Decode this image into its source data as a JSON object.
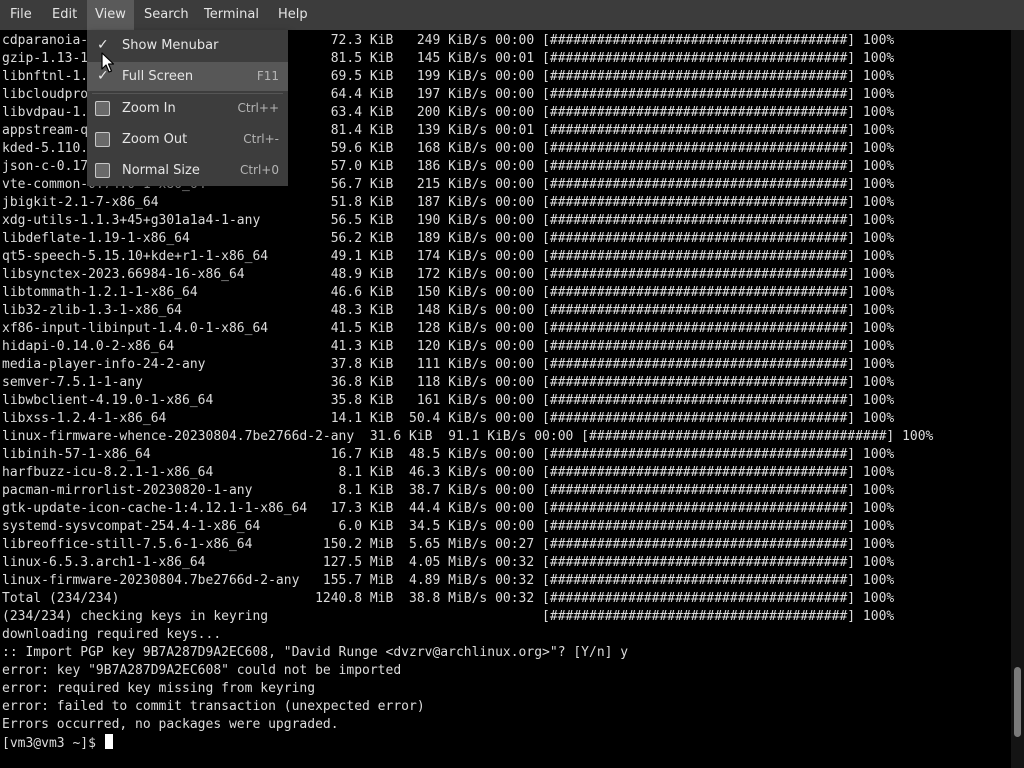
{
  "menubar": {
    "items": [
      {
        "label": "File"
      },
      {
        "label": "Edit"
      },
      {
        "label": "View"
      },
      {
        "label": "Search"
      },
      {
        "label": "Terminal"
      },
      {
        "label": "Help"
      }
    ]
  },
  "view_menu": {
    "items": [
      {
        "label": "Show Menubar",
        "accel": "",
        "checked": true
      },
      {
        "label": "Full Screen",
        "accel": "F11",
        "checked": true
      },
      {
        "label": "Zoom In",
        "accel": "Ctrl++",
        "icon": "zoom-in-icon"
      },
      {
        "label": "Zoom Out",
        "accel": "Ctrl+-",
        "icon": "zoom-out-icon"
      },
      {
        "label": "Normal Size",
        "accel": "Ctrl+0",
        "icon": "zoom-reset-icon"
      }
    ],
    "check_glyph": "✓"
  },
  "terminal": {
    "lines": [
      "cdparanoia-10.2-9-x86_64                  72.3 KiB   249 KiB/s 00:00 [######################################] 100%",
      "gzip-1.13-1-x86_64                        81.5 KiB   145 KiB/s 00:01 [######################################] 100%",
      "libnftnl-1.2.6-1-x86_64                   69.5 KiB   199 KiB/s 00:00 [######################################] 100%",
      "libcloudproviders-0.3.4-1-x86_64          64.4 KiB   197 KiB/s 00:00 [######################################] 100%",
      "libvdpau-1.5-2-x86_64                     63.4 KiB   200 KiB/s 00:00 [######################################] 100%",
      "appstream-qt-0.16.3-1-x86_64              81.4 KiB   139 KiB/s 00:01 [######################################] 100%",
      "kded-5.110.0-1-x86_64                     59.6 KiB   168 KiB/s 00:00 [######################################] 100%",
      "json-c-0.17-1-x86_64                      57.0 KiB   186 KiB/s 00:00 [######################################] 100%",
      "vte-common-0.74.0-1-x86_64                56.7 KiB   215 KiB/s 00:00 [######################################] 100%",
      "jbigkit-2.1-7-x86_64                      51.8 KiB   187 KiB/s 00:00 [######################################] 100%",
      "xdg-utils-1.1.3+45+g301a1a4-1-any         56.5 KiB   190 KiB/s 00:00 [######################################] 100%",
      "libdeflate-1.19-1-x86_64                  56.2 KiB   189 KiB/s 00:00 [######################################] 100%",
      "qt5-speech-5.15.10+kde+r1-1-x86_64        49.1 KiB   174 KiB/s 00:00 [######################################] 100%",
      "libsynctex-2023.66984-16-x86_64           48.9 KiB   172 KiB/s 00:00 [######################################] 100%",
      "libtommath-1.2.1-1-x86_64                 46.6 KiB   150 KiB/s 00:00 [######################################] 100%",
      "lib32-zlib-1.3-1-x86_64                   48.3 KiB   148 KiB/s 00:00 [######################################] 100%",
      "xf86-input-libinput-1.4.0-1-x86_64        41.5 KiB   128 KiB/s 00:00 [######################################] 100%",
      "hidapi-0.14.0-2-x86_64                    41.3 KiB   120 KiB/s 00:00 [######################################] 100%",
      "media-player-info-24-2-any                37.8 KiB   111 KiB/s 00:00 [######################################] 100%",
      "semver-7.5.1-1-any                        36.8 KiB   118 KiB/s 00:00 [######################################] 100%",
      "libwbclient-4.19.0-1-x86_64               35.8 KiB   161 KiB/s 00:00 [######################################] 100%",
      "libxss-1.2.4-1-x86_64                     14.1 KiB  50.4 KiB/s 00:00 [######################################] 100%",
      "linux-firmware-whence-20230804.7be2766d-2-any  31.6 KiB  91.1 KiB/s 00:00 [######################################] 100%",
      "libinih-57-1-x86_64                       16.7 KiB  48.5 KiB/s 00:00 [######################################] 100%",
      "harfbuzz-icu-8.2.1-1-x86_64                8.1 KiB  46.3 KiB/s 00:00 [######################################] 100%",
      "pacman-mirrorlist-20230820-1-any           8.1 KiB  38.7 KiB/s 00:00 [######################################] 100%",
      "gtk-update-icon-cache-1:4.12.1-1-x86_64   17.3 KiB  44.4 KiB/s 00:00 [######################################] 100%",
      "systemd-sysvcompat-254.4-1-x86_64          6.0 KiB  34.5 KiB/s 00:00 [######################################] 100%",
      "libreoffice-still-7.5.6-1-x86_64         150.2 MiB  5.65 MiB/s 00:27 [######################################] 100%",
      "linux-6.5.3.arch1-1-x86_64               127.5 MiB  4.05 MiB/s 00:32 [######################################] 100%",
      "linux-firmware-20230804.7be2766d-2-any   155.7 MiB  4.89 MiB/s 00:32 [######################################] 100%",
      "Total (234/234)                         1240.8 MiB  38.8 MiB/s 00:32 [######################################] 100%",
      "(234/234) checking keys in keyring                                   [######################################] 100%",
      "downloading required keys...",
      ":: Import PGP key 9B7A287D9A2EC608, \"David Runge <dvzrv@archlinux.org>\"? [Y/n] y",
      "error: key \"9B7A287D9A2EC608\" could not be imported",
      "error: required key missing from keyring",
      "error: failed to commit transaction (unexpected error)",
      "Errors occurred, no packages were upgraded."
    ],
    "prompt": "[vm3@vm3 ~]$ ",
    "scroll_position": 0.96
  },
  "colors": {
    "background": "#000000",
    "text": "#dcdcdc",
    "menubar": "#3c3c3c",
    "menu_active": "#5a5a5a"
  }
}
